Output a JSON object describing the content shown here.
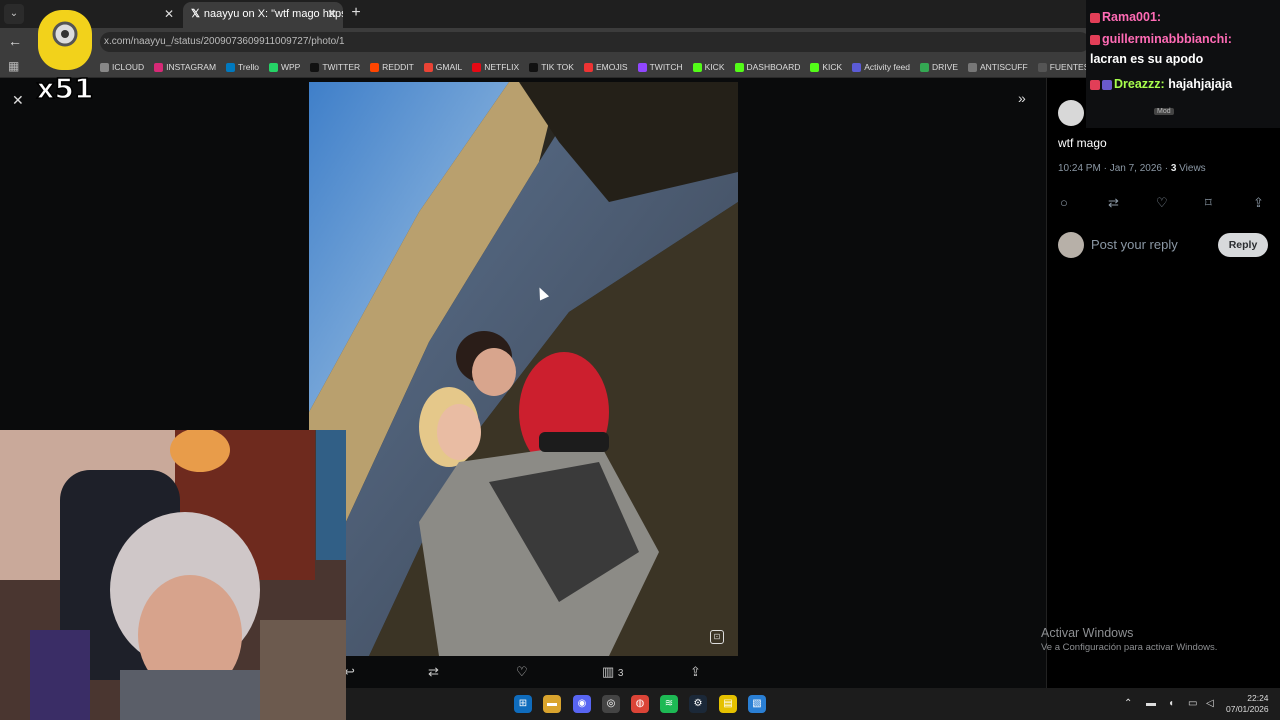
{
  "browser": {
    "tab_inactive_close": "✕",
    "tab_active_title": "naayyu on X: \"wtf mago https:/",
    "tab_active_close": "✕",
    "new_tab": "+",
    "url": "x.com/naayyu_/status/2009073609911009727/photo/1",
    "bookmarks": [
      "ICLOUD",
      "INSTAGRAM",
      "Trello",
      "WPP",
      "TWITTER",
      "REDDIT",
      "GMAIL",
      "NETFLIX",
      "TIK TOK",
      "EMOJIS",
      "TWITCH",
      "KICK",
      "DASHBOARD",
      "KICK",
      "Activity feed",
      "DRIVE",
      "ANTISCUFF",
      "FUENTES"
    ]
  },
  "overlay": {
    "combo": "x51"
  },
  "chat": {
    "lines": [
      {
        "user": "Rama001:",
        "text": ""
      },
      {
        "user": "guillerminabbbianchi:",
        "text": "lacran es su apodo"
      },
      {
        "user": "Dreazzz:",
        "text": "hajahjajaja"
      }
    ],
    "mod_badge": "Mod"
  },
  "post": {
    "author": "naayyu",
    "text": "wtf mago",
    "timestamp": "10:24 PM · Jan 7, 2026 · ",
    "views_count": "3",
    "views_label": " Views",
    "reply_placeholder": "Post your reply",
    "reply_button": "Reply"
  },
  "photo_actions": {
    "views": "3"
  },
  "windows": {
    "activate_title": "Activar Windows",
    "activate_sub": "Ve a Configuración para activar Windows."
  },
  "clock": {
    "time": "22:24",
    "date": "07/01/2026"
  },
  "colors": {
    "chat_user": "#ff6bb5",
    "chat_user_green": "#a8ff4d",
    "reply_button_bg": "#d7d9db"
  }
}
